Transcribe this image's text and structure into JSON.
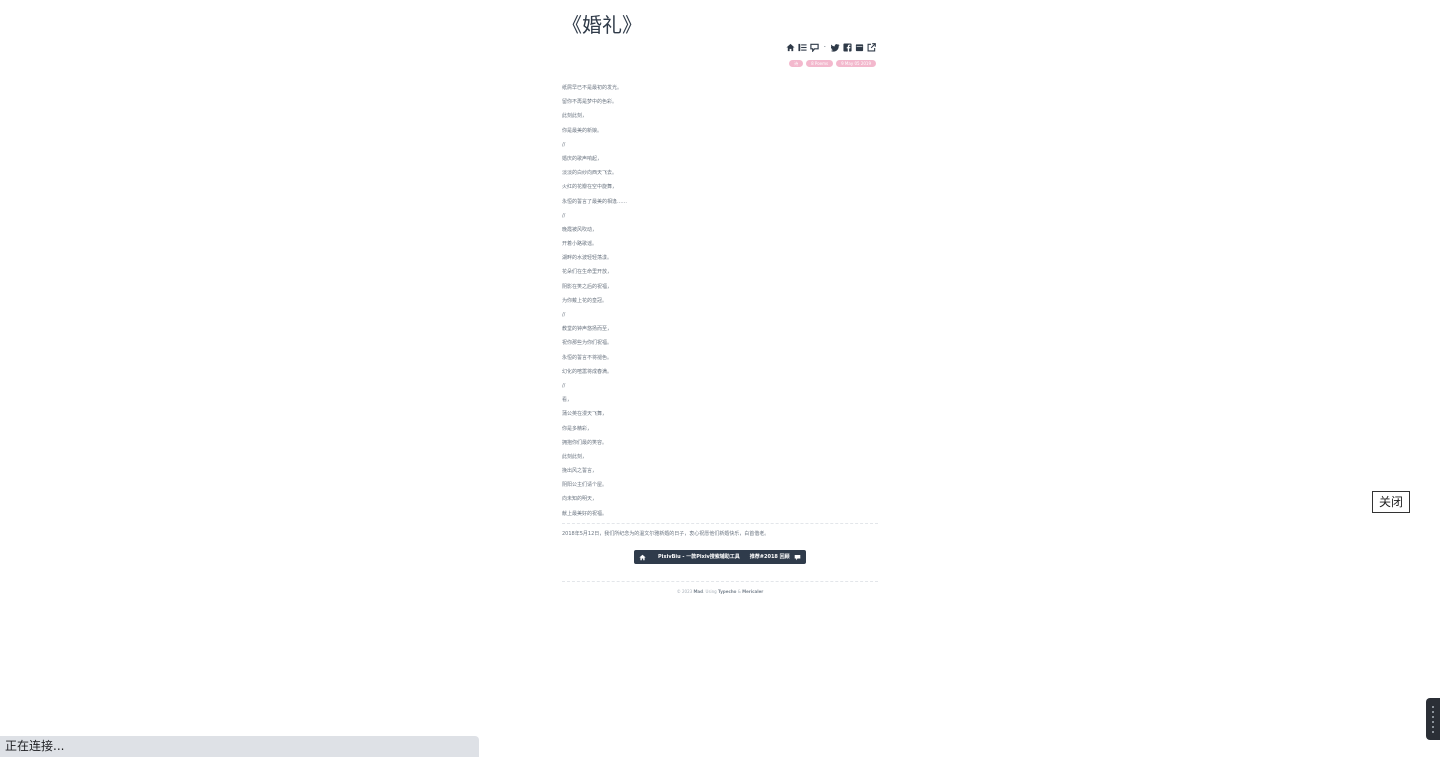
{
  "article": {
    "title": "《婚礼》",
    "toolbar": {
      "icons": [
        "home-icon",
        "list-icon",
        "comment-icon",
        "twitter-icon",
        "facebook-icon",
        "calendar-icon",
        "external-link-icon"
      ],
      "separator": "·"
    },
    "tags": [
      "诗",
      "8 Poems",
      "9 May 05 2019"
    ],
    "poem_lines": [
      "纸屑早已不是最初的发光。",
      "留你不再是梦中的色彩。",
      "此刻此刻，",
      "你是最美的新娘。",
      "//",
      "婚庆的歌声响起，",
      "淡淡的白纱向西天飞去。",
      "火红的花瓣在空中旋舞，",
      "永恒的誓言了最美的相逢……",
      "//",
      "晚霞被风吹动，",
      "开着小路歌谣。",
      "湖畔的水波轻轻荡漾。",
      "花朵们在生命里开放，",
      "阴影在笑之后的祝福，",
      "为你戴上花的皇冠。",
      "//",
      "教堂的钟声悠扬而至，",
      "祝你那些为你们祝福。",
      "永恒的誓言不将褪色。",
      "幻化的喧嚣将成春满。",
      "//",
      "看，",
      "蒲公英在漫天飞舞，",
      "你是多精彩，",
      "拥抱你们最的笑容。",
      "此刻此刻，",
      "挽出风之誓言，",
      "阴阳公主们请个屋。",
      "向未知的明天，",
      "献上最美好的祝福。"
    ],
    "note": "2018年5月12日，我们所纪念为的温文尔雅新婚的日子，衷心祝愿他们新婚快乐，白首偕老。",
    "promo": {
      "link1": "PixivBiu - 一款Pixiv搜索辅助工具",
      "link2": "推荐#2018 回顾"
    },
    "footer": {
      "prefix": "© 2023",
      "author": "Mad",
      "middle": ". Using",
      "engine": "Typecho",
      "amp": "&",
      "theme": "Mericaler"
    }
  },
  "close_button": "关闭",
  "status_bar": "正在连接...",
  "colors": {
    "tag": "#f3b8cd",
    "promo_bg": "#2f3b4b",
    "status_bg": "#dee1e6"
  }
}
